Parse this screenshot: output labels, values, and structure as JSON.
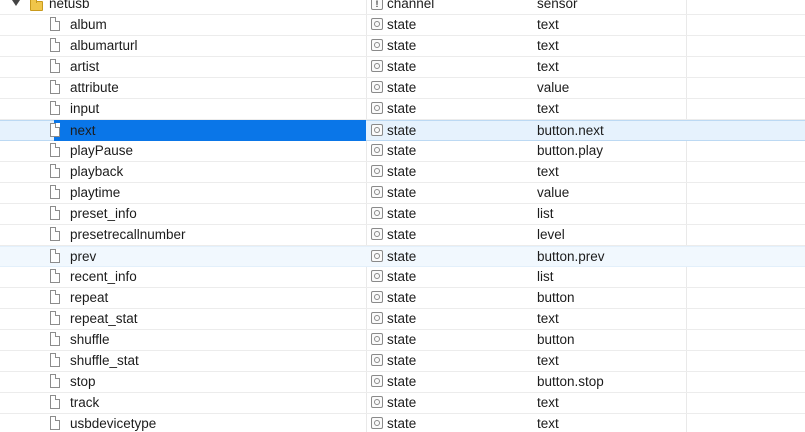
{
  "tree": {
    "parent": {
      "name": "netusb",
      "type": "channel",
      "role": "sensor",
      "icon": "folder-icon",
      "type_icon": "channel-icon"
    },
    "items": [
      {
        "name": "album",
        "type": "state",
        "role": "text"
      },
      {
        "name": "albumarturl",
        "type": "state",
        "role": "text"
      },
      {
        "name": "artist",
        "type": "state",
        "role": "text"
      },
      {
        "name": "attribute",
        "type": "state",
        "role": "value"
      },
      {
        "name": "input",
        "type": "state",
        "role": "text"
      },
      {
        "name": "next",
        "type": "state",
        "role": "button.next",
        "selected": true
      },
      {
        "name": "playPause",
        "type": "state",
        "role": "button.play"
      },
      {
        "name": "playback",
        "type": "state",
        "role": "text"
      },
      {
        "name": "playtime",
        "type": "state",
        "role": "value"
      },
      {
        "name": "preset_info",
        "type": "state",
        "role": "list"
      },
      {
        "name": "presetrecallnumber",
        "type": "state",
        "role": "level"
      },
      {
        "name": "prev",
        "type": "state",
        "role": "button.prev",
        "hover": true
      },
      {
        "name": "recent_info",
        "type": "state",
        "role": "list"
      },
      {
        "name": "repeat",
        "type": "state",
        "role": "button"
      },
      {
        "name": "repeat_stat",
        "type": "state",
        "role": "text"
      },
      {
        "name": "shuffle",
        "type": "state",
        "role": "button"
      },
      {
        "name": "shuffle_stat",
        "type": "state",
        "role": "text"
      },
      {
        "name": "stop",
        "type": "state",
        "role": "button.stop"
      },
      {
        "name": "track",
        "type": "state",
        "role": "text"
      },
      {
        "name": "usbdevicetype",
        "type": "state",
        "role": "text"
      }
    ]
  },
  "colors": {
    "selection": "#0a76e8",
    "row_selected_bg": "#e6f2fd",
    "row_hover_bg": "#f1f8fe",
    "folder": "#f0c64a"
  }
}
